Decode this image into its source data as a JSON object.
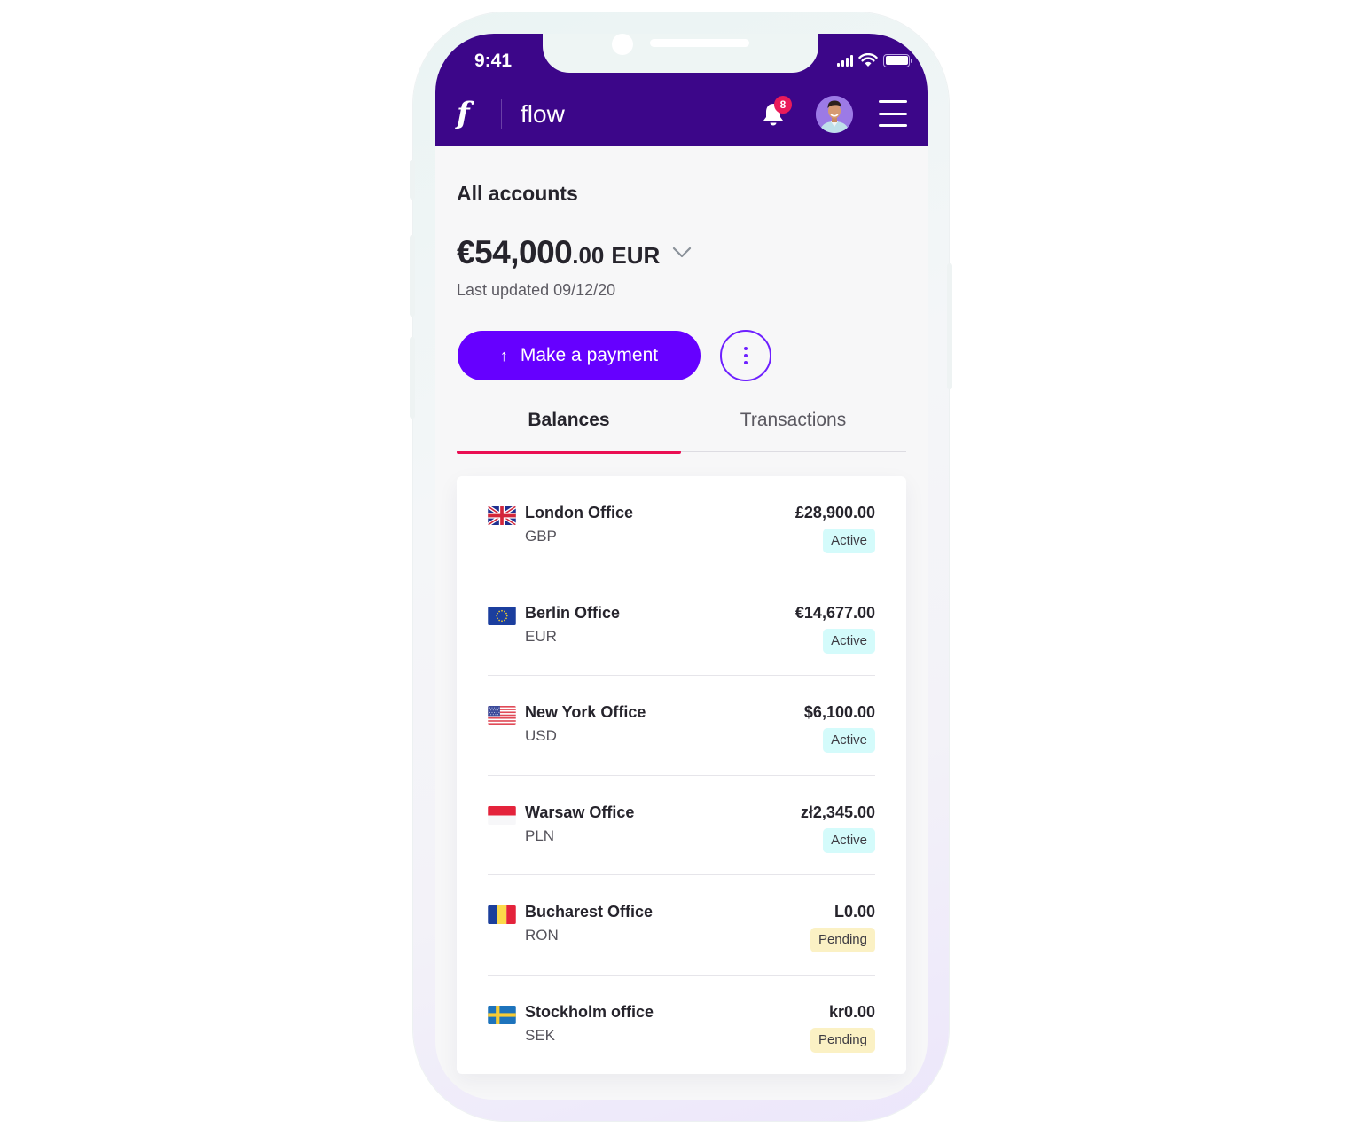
{
  "status_bar": {
    "time": "9:41"
  },
  "header": {
    "logo_glyph": "f",
    "brand_name": "flow",
    "notifications_count": "8",
    "icons": [
      "bell-icon",
      "avatar",
      "hamburger-menu-icon"
    ],
    "brand_color": "#3c0689"
  },
  "summary": {
    "title": "All accounts",
    "total_major": "€54,000",
    "total_minor": ".00",
    "total_currency": "EUR",
    "last_updated": "Last updated 09/12/20"
  },
  "actions": {
    "make_payment_label": "Make a payment",
    "make_payment_icon": "arrow-up-icon",
    "more_icon": "vertical-dots-icon",
    "accent_color": "#6600ff"
  },
  "tabs": [
    {
      "label": "Balances",
      "active": true
    },
    {
      "label": "Transactions",
      "active": false
    }
  ],
  "accounts": [
    {
      "name": "London Office",
      "currency": "GBP",
      "amount": "£28,900.00",
      "status": "Active",
      "flag": "uk-flag-icon"
    },
    {
      "name": "Berlin Office",
      "currency": "EUR",
      "amount": "€14,677.00",
      "status": "Active",
      "flag": "eu-flag-icon"
    },
    {
      "name": "New York Office",
      "currency": "USD",
      "amount": "$6,100.00",
      "status": "Active",
      "flag": "us-flag-icon"
    },
    {
      "name": "Warsaw Office",
      "currency": "PLN",
      "amount": "zł2,345.00",
      "status": "Active",
      "flag": "poland-flag-icon"
    },
    {
      "name": "Bucharest Office",
      "currency": "RON",
      "amount": "L0.00",
      "status": "Pending",
      "flag": "romania-flag-icon"
    },
    {
      "name": "Stockholm office",
      "currency": "SEK",
      "amount": "kr0.00",
      "status": "Pending",
      "flag": "sweden-flag-icon"
    }
  ],
  "status_colors": {
    "Active": "#d4fbfb",
    "Pending": "#fbf1c4"
  }
}
